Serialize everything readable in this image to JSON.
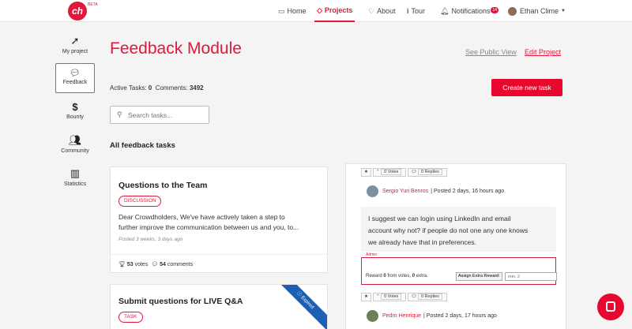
{
  "topbar": {
    "logo_text": "ch",
    "logo_beta": "BETA",
    "nav": {
      "home": "Home",
      "projects": "Projects",
      "about": "About",
      "tour": "Tour",
      "notifications": "Notifications",
      "notifications_count": "14",
      "user": "Ethan Clime"
    }
  },
  "sidebar": {
    "items": [
      {
        "label": "My project",
        "icon": "rocket-icon"
      },
      {
        "label": "Feedback",
        "icon": "comment-icon"
      },
      {
        "label": "Bounty",
        "icon": "dollar-icon"
      },
      {
        "label": "Community",
        "icon": "users-icon"
      },
      {
        "label": "Statistics",
        "icon": "bar-chart-icon"
      }
    ]
  },
  "header": {
    "title": "Feedback Module",
    "see_public_view": "See Public View",
    "edit_project": "Edit Project",
    "active_tasks_label": "Active Tasks:",
    "active_tasks_value": "0",
    "comments_label": "Comments:",
    "comments_value": "3492",
    "create_task": "Create new task",
    "search_placeholder": "Search tasks...",
    "section_title": "All feedback tasks"
  },
  "tasks": [
    {
      "title": "Questions to the Team",
      "tag": "DISCUSSION",
      "description_line1": "Dear Crowdholders, We've have actively taken a step to",
      "description_line2": "further improve the communication between us and you, to...",
      "posted": "Posted 3 weeks, 3 days ago",
      "votes": "53",
      "votes_label": "votes",
      "comments": "54",
      "comments_label": "comments"
    },
    {
      "title": "Submit questions for LIVE Q&A",
      "tag": "TASK",
      "ribbon": "Expired"
    }
  ],
  "comments_panel": {
    "votes_label": "0 Votes",
    "replies_label": "0 Replies",
    "comment1": {
      "author": "Sergio Yuri Benros",
      "posted": "| Posted 2 days, 16 hours ago",
      "line1": "I suggest we can login using LinkedIn and email",
      "line2": "account why not? if people do not one any one knows",
      "line3": "we already have that in preferences."
    },
    "admin_label": "Admin",
    "reward_prefix": "Reward",
    "reward_value": "0",
    "reward_middle": "from votes,",
    "reward_extra_value": "0",
    "reward_suffix": "extra.",
    "assign_extra_label": "Assign Extra Reward:",
    "reward_input_placeholder": "min. 2",
    "comment2": {
      "author": "Pedro Henrique",
      "posted": "| Posted 2 days, 17 hours ago"
    }
  },
  "colors": {
    "accent": "#e0183a",
    "ribbon": "#1e5fb5"
  }
}
